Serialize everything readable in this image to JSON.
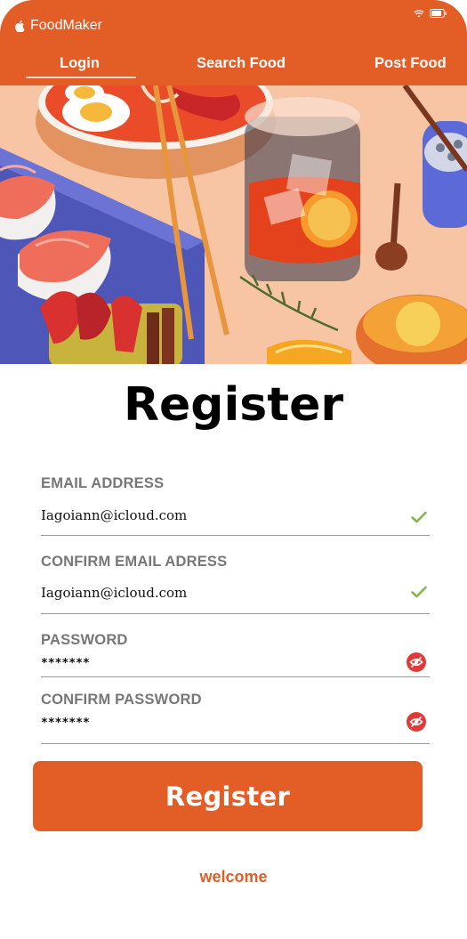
{
  "app": {
    "title": "FoodMaker"
  },
  "tabs": [
    {
      "label": "Login"
    },
    {
      "label": "Search Food"
    },
    {
      "label": "Post Food"
    }
  ],
  "form": {
    "title": "Register",
    "email": {
      "label": "EMAIL ADDRESS",
      "value": "Iagoiann@icloud.com"
    },
    "confirm_email": {
      "label": "CONFIRM EMAIL ADRESS",
      "value": "Iagoiann@icloud.com"
    },
    "password": {
      "label": "PASSWORD",
      "value": "*******"
    },
    "confirm_password": {
      "label": "CONFIRM PASSWORD",
      "value": "*******"
    },
    "submit_label": "Register",
    "footer_link": "welcome"
  },
  "colors": {
    "brand": "#e25e26",
    "valid": "#8ab54a",
    "reveal": "#e03b3b"
  }
}
